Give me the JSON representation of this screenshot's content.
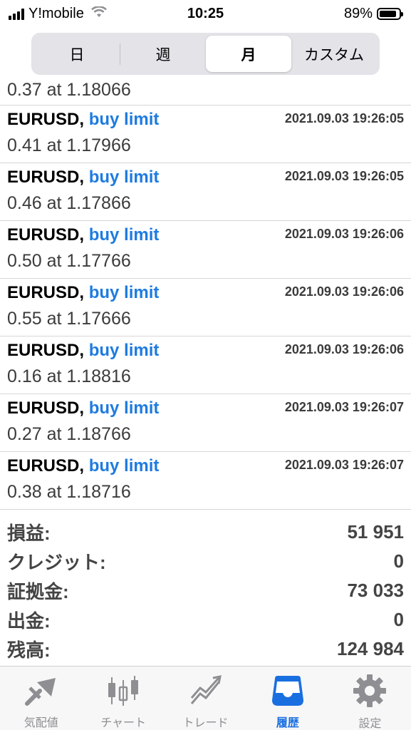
{
  "status_bar": {
    "carrier": "Y!mobile",
    "time": "10:25",
    "battery": "89%"
  },
  "segments": [
    {
      "label": "日",
      "active": false
    },
    {
      "label": "週",
      "active": false
    },
    {
      "label": "月",
      "active": true
    },
    {
      "label": "カスタム",
      "active": false
    }
  ],
  "orders": {
    "partial_first_detail": "0.37 at 1.18066",
    "rows": [
      {
        "symbol": "EURUSD,",
        "type": "buy limit",
        "time": "2021.09.03 19:26:05",
        "detail": "0.41 at 1.17966"
      },
      {
        "symbol": "EURUSD,",
        "type": "buy limit",
        "time": "2021.09.03 19:26:05",
        "detail": "0.46 at 1.17866"
      },
      {
        "symbol": "EURUSD,",
        "type": "buy limit",
        "time": "2021.09.03 19:26:06",
        "detail": "0.50 at 1.17766"
      },
      {
        "symbol": "EURUSD,",
        "type": "buy limit",
        "time": "2021.09.03 19:26:06",
        "detail": "0.55 at 1.17666"
      },
      {
        "symbol": "EURUSD,",
        "type": "buy limit",
        "time": "2021.09.03 19:26:06",
        "detail": "0.16 at 1.18816"
      },
      {
        "symbol": "EURUSD,",
        "type": "buy limit",
        "time": "2021.09.03 19:26:07",
        "detail": "0.27 at 1.18766"
      },
      {
        "symbol": "EURUSD,",
        "type": "buy limit",
        "time": "2021.09.03 19:26:07",
        "detail": "0.38 at 1.18716"
      }
    ]
  },
  "summary": [
    {
      "label": "損益:",
      "value": "51 951"
    },
    {
      "label": "クレジット:",
      "value": "0"
    },
    {
      "label": "証拠金:",
      "value": "73 033"
    },
    {
      "label": "出金:",
      "value": "0"
    },
    {
      "label": "残高:",
      "value": "124 984"
    }
  ],
  "tabbar": {
    "items": [
      {
        "label": "気配値",
        "icon": "quotes-icon",
        "active": false
      },
      {
        "label": "チャート",
        "icon": "chart-icon",
        "active": false
      },
      {
        "label": "トレード",
        "icon": "trade-icon",
        "active": false
      },
      {
        "label": "履歴",
        "icon": "history-icon",
        "active": true
      },
      {
        "label": "設定",
        "icon": "settings-icon",
        "active": false
      }
    ]
  },
  "colors": {
    "accent": "#1a6fe0",
    "order_type": "#1e7be0",
    "inactive": "#8e8e93"
  }
}
